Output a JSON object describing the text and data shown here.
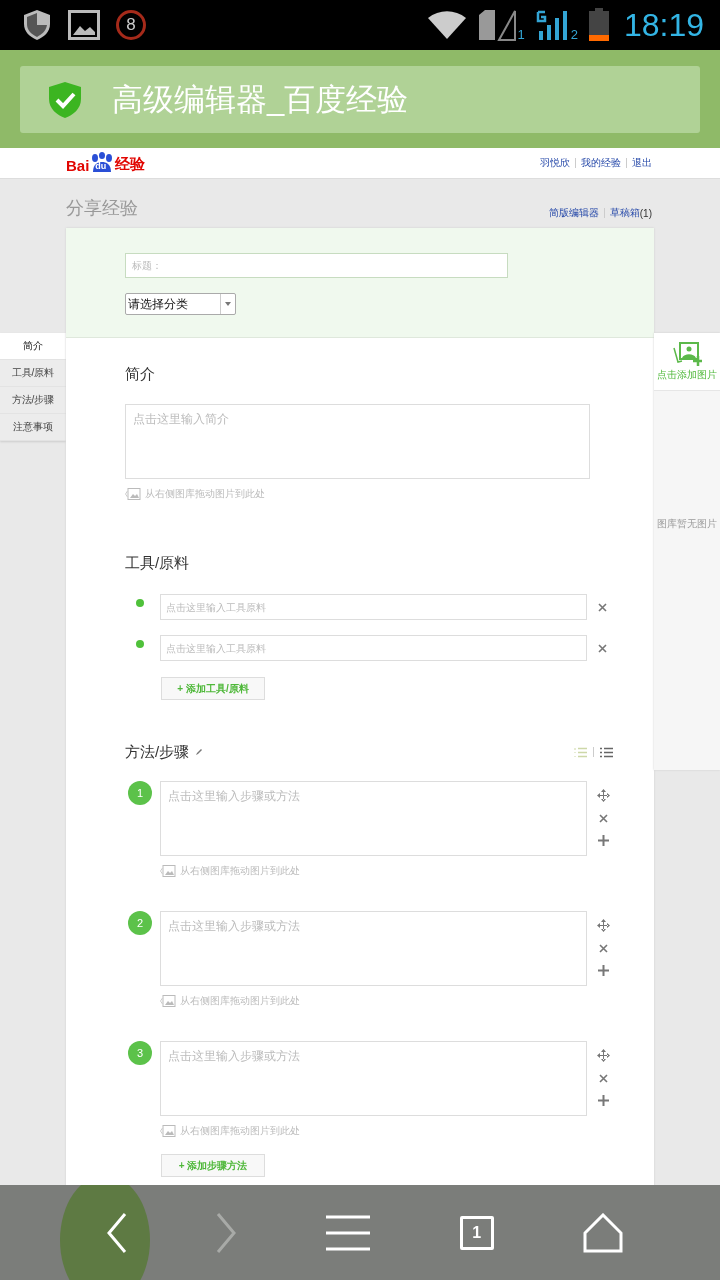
{
  "status_bar": {
    "notification_count": "8",
    "sim1_label": "1",
    "sim2_label": "2",
    "time": "18:19"
  },
  "title_bar": {
    "title": "高级编辑器_百度经验"
  },
  "site_header": {
    "logo": {
      "part_1": "Bai",
      "part_2": "du",
      "part_3": "经验"
    },
    "user_links": [
      "羽悦欣",
      "我的经验",
      "退出"
    ]
  },
  "page": {
    "heading": "分享经验",
    "simple_editor_link": "简版编辑器",
    "drafts_link": "草稿箱",
    "drafts_count": "(1)"
  },
  "form": {
    "title_placeholder": "标题：",
    "category": "请选择分类"
  },
  "section_nav": [
    {
      "label": "简介",
      "selected": true
    },
    {
      "label": "工具/原料",
      "selected": false
    },
    {
      "label": "方法/步骤",
      "selected": false
    },
    {
      "label": "注意事项",
      "selected": false
    }
  ],
  "gallery": {
    "add_label": "点击添加图片",
    "empty_text": "图库暂无图片"
  },
  "intro": {
    "heading": "简介",
    "placeholder": "点击这里输入简介",
    "drop_hint": "从右侧图库拖动图片到此处"
  },
  "tools": {
    "heading": "工具/原料",
    "items": [
      {
        "placeholder": "点击这里输入工具原料"
      },
      {
        "placeholder": "点击这里输入工具原料"
      }
    ],
    "add_button": "+ 添加工具/原料"
  },
  "steps": {
    "heading": "方法/步骤",
    "items": [
      {
        "number": "1",
        "placeholder": "点击这里输入步骤或方法",
        "drop_hint": "从右侧图库拖动图片到此处"
      },
      {
        "number": "2",
        "placeholder": "点击这里输入步骤或方法",
        "drop_hint": "从右侧图库拖动图片到此处"
      },
      {
        "number": "3",
        "placeholder": "点击这里输入步骤或方法",
        "drop_hint": "从右侧图库拖动图片到此处"
      }
    ],
    "add_button": "+ 添加步骤方法"
  },
  "nav_bar": {
    "tab_count": "1",
    "forward_disabled": true
  }
}
